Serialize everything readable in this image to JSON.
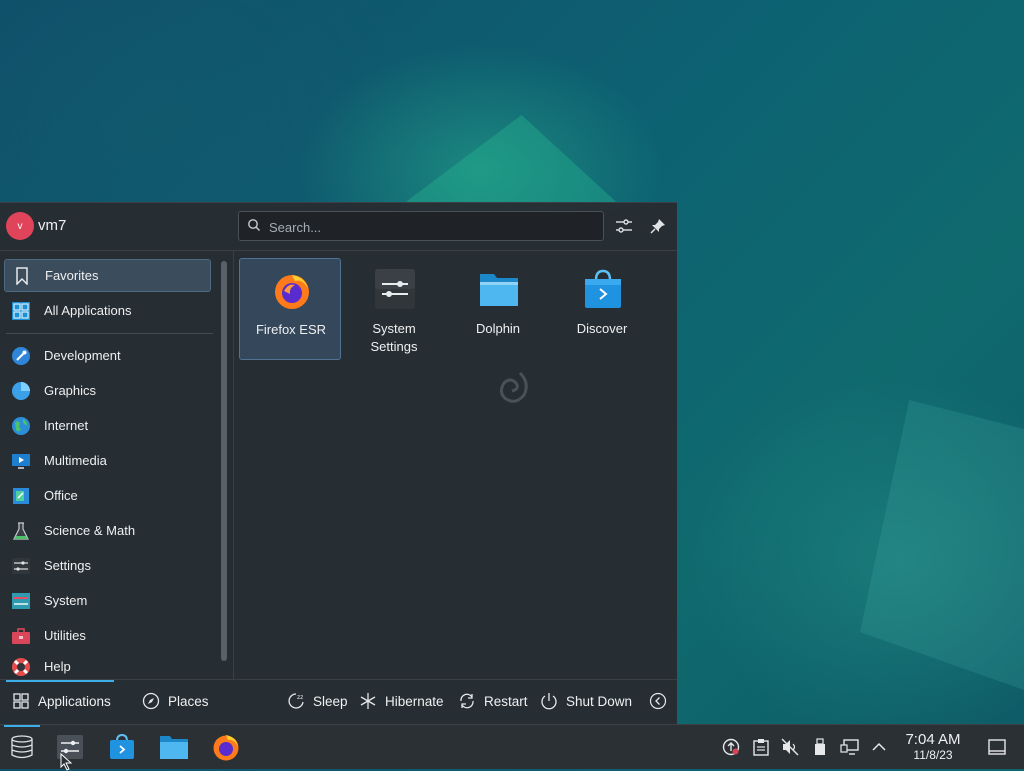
{
  "user": {
    "initial": "v",
    "name": "vm7"
  },
  "search": {
    "placeholder": "Search..."
  },
  "sidebar": {
    "categories": [
      {
        "label": "Favorites"
      },
      {
        "label": "All Applications"
      },
      {
        "label": "Development"
      },
      {
        "label": "Graphics"
      },
      {
        "label": "Internet"
      },
      {
        "label": "Multimedia"
      },
      {
        "label": "Office"
      },
      {
        "label": "Science & Math"
      },
      {
        "label": "Settings"
      },
      {
        "label": "System"
      },
      {
        "label": "Utilities"
      },
      {
        "label": "Help"
      }
    ]
  },
  "favorites": [
    {
      "label": "Firefox ESR",
      "icon": "firefox-icon"
    },
    {
      "label": "System Settings",
      "icon": "system-settings-icon"
    },
    {
      "label": "Dolphin",
      "icon": "folder-icon"
    },
    {
      "label": "Discover",
      "icon": "discover-bag-icon"
    }
  ],
  "footer": {
    "applications": "Applications",
    "places": "Places",
    "sleep": "Sleep",
    "hibernate": "Hibernate",
    "restart": "Restart",
    "shutdown": "Shut Down"
  },
  "clock": {
    "time": "7:04 AM",
    "date": "11/8/23"
  },
  "colors": {
    "accent": "#3daee9",
    "avatar": "#e0445a"
  }
}
